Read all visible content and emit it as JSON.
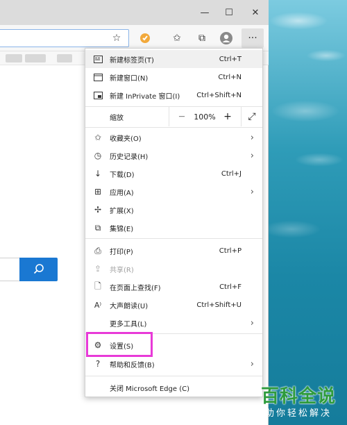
{
  "window": {
    "minimize": "—",
    "maximize": "☐",
    "close": "✕"
  },
  "toolbar": {
    "star": "☆",
    "favorites": "✩",
    "collections": "⧉",
    "more": "···"
  },
  "search": {
    "icon": "⚲"
  },
  "menu": {
    "items": [
      {
        "label": "新建标签页(T)",
        "shortcut": "Ctrl+T"
      },
      {
        "label": "新建窗口(N)",
        "shortcut": "Ctrl+N"
      },
      {
        "label": "新建 InPrivate 窗口(I)",
        "shortcut": "Ctrl+Shift+N"
      },
      {
        "label": "收藏夹(O)"
      },
      {
        "label": "历史记录(H)"
      },
      {
        "label": "下载(D)",
        "shortcut": "Ctrl+J"
      },
      {
        "label": "应用(A)"
      },
      {
        "label": "扩展(X)"
      },
      {
        "label": "集锦(E)"
      },
      {
        "label": "打印(P)",
        "shortcut": "Ctrl+P"
      },
      {
        "label": "共享(R)"
      },
      {
        "label": "在页面上查找(F)",
        "shortcut": "Ctrl+F"
      },
      {
        "label": "大声朗读(U)",
        "shortcut": "Ctrl+Shift+U"
      },
      {
        "label": "更多工具(L)"
      },
      {
        "label": "设置(S)"
      },
      {
        "label": "帮助和反馈(B)"
      },
      {
        "label": "关闭 Microsoft Edge (C)"
      }
    ],
    "zoom": {
      "label": "缩放",
      "minus": "—",
      "value": "100%",
      "plus": "+",
      "fullscreen": "⤢"
    }
  },
  "watermark": {
    "title": "百科全说",
    "subtitle": "助你轻松解决"
  },
  "colors": {
    "highlight": "#e83ad8",
    "accent": "#1a78d2",
    "watermark": "#2e9b3c"
  }
}
